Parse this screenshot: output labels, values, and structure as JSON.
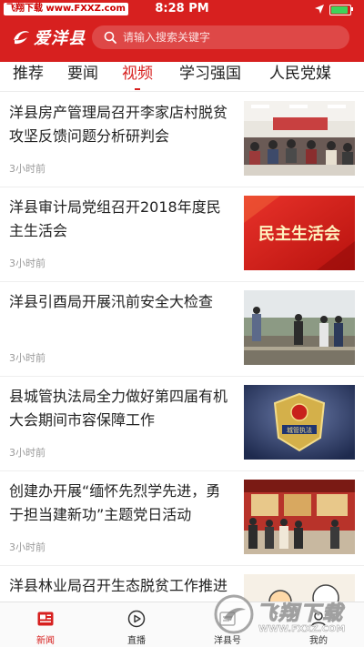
{
  "status_bar": {
    "carrier_a": "飞翔下载",
    "carrier_b": "www.FXXZ.com",
    "time": "8:28 PM",
    "battery_level": 0.88
  },
  "header": {
    "logo_text": "爱洋县",
    "search_placeholder": "请输入搜索关键字"
  },
  "tabs": [
    {
      "label": "推荐",
      "active": false
    },
    {
      "label": "要闻",
      "active": false
    },
    {
      "label": "视频",
      "active": true
    },
    {
      "label": "学习强国",
      "active": false
    },
    {
      "label": "人民党媒",
      "active": false
    }
  ],
  "news": [
    {
      "title": "洋县房产管理局召开李家店村脱贫攻坚反馈问题分析研判会",
      "time": "3小时前",
      "thumb": "meeting-room-photo"
    },
    {
      "title": "洋县审计局党组召开2018年度民主生活会",
      "time": "3小时前",
      "thumb_text": "民主生活会"
    },
    {
      "title": "洋县引酉局开展汛前安全大检查",
      "time": "3小时前",
      "thumb": "river-inspection-photo"
    },
    {
      "title": "县城管执法局全力做好第四届有机大会期间市容保障工作",
      "time": "3小时前",
      "thumb_text": "城管执法"
    },
    {
      "title": "创建办开展“缅怀先烈学先进，勇于担当建新功”主题党日活动",
      "time": "3小时前",
      "thumb": "exhibition-hall-photo"
    },
    {
      "title": "洋县林业局召开生态脱贫工作推进会",
      "time": "",
      "thumb": "cartoon-illustration"
    }
  ],
  "bottom_nav": [
    {
      "label": "新闻",
      "icon": "news-icon",
      "active": true
    },
    {
      "label": "直播",
      "icon": "play-icon",
      "active": false
    },
    {
      "label": "洋县号",
      "icon": "account-icon",
      "active": false
    },
    {
      "label": "我的",
      "icon": "user-icon",
      "active": false
    }
  ],
  "watermark": {
    "text": "飞翔下载",
    "url": "WWW.FXXZ.COM"
  },
  "colors": {
    "brand": "#d7201f",
    "text": "#222222",
    "meta": "#9a9a9a"
  }
}
